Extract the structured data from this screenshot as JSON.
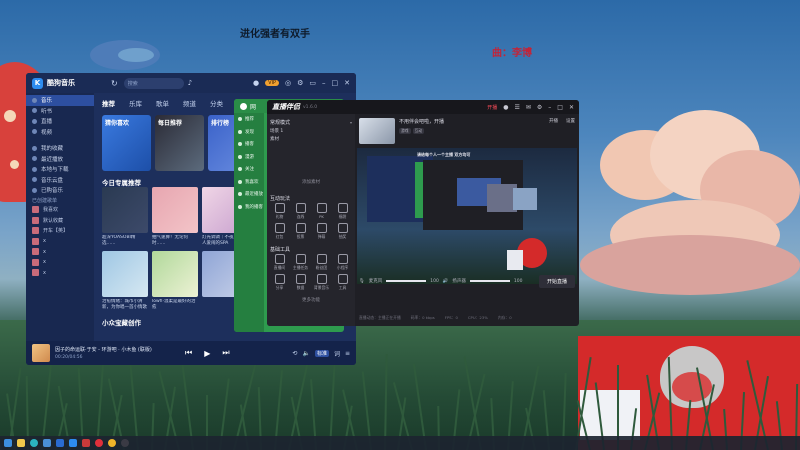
{
  "desktop": {
    "lyric_line": "进化强者有双手",
    "lyric_credit": "曲：李博"
  },
  "kugou": {
    "app_title": "酷狗音乐",
    "search_placeholder": "搜索",
    "sidebar": [
      {
        "label": "音乐",
        "active": true
      },
      {
        "label": "听书",
        "active": false
      },
      {
        "label": "直播",
        "active": false
      },
      {
        "label": "视频",
        "active": false
      },
      {
        "label": "我的收藏",
        "active": false
      },
      {
        "label": "最近播放",
        "active": false
      },
      {
        "label": "本地与下载",
        "active": false
      },
      {
        "label": "音乐云盘",
        "active": false
      },
      {
        "label": "已购音乐",
        "active": false
      }
    ],
    "playlist_header": "已创建歌单",
    "mini_playlists": [
      "我喜欢",
      "默认收藏",
      "开车【英】",
      "x",
      "x",
      "x",
      "x"
    ],
    "tabs": [
      {
        "label": "推荐",
        "active": true
      },
      {
        "label": "乐库",
        "active": false
      },
      {
        "label": "歌单",
        "active": false
      },
      {
        "label": "频道",
        "active": false
      },
      {
        "label": "分类",
        "active": false
      },
      {
        "label": "视频",
        "active": false
      }
    ],
    "cards": [
      {
        "title": "猜你喜欢",
        "subtitle": "",
        "style": "c1"
      },
      {
        "title": "每日推荐",
        "subtitle": "",
        "style": "c2"
      },
      {
        "title": "排行榜",
        "subtitle": "",
        "style": "c3"
      },
      {
        "title": "",
        "subtitle": "",
        "style": "c4"
      }
    ],
    "section_featured": "今日专属推荐",
    "albums_row1": [
      {
        "caption": "超深YOASOBI精选……",
        "colors": [
          "#2a3a52",
          "#3d4a6a"
        ]
      },
      {
        "caption": "抽气速算！无论何时……",
        "colors": [
          "#e7a6b0",
          "#f3c4c8"
        ]
      },
      {
        "caption": "灯光调调｜不夜真……人爱闹的SPA",
        "colors": [
          "#f0d6e6",
          "#c9a2cf"
        ]
      },
      {
        "caption": "",
        "colors": [
          "#d9e8f5",
          "#a4c2e0"
        ]
      }
    ],
    "albums_row2": [
      {
        "caption": "治愈情绪：城市小清新，为你唱一首小情歌",
        "colors": [
          "#9fc7e4",
          "#d6e8f2"
        ]
      },
      {
        "caption": "lowfi·温柔是最好的治愈",
        "colors": [
          "#b0d89a",
          "#edf2d5"
        ]
      },
      {
        "caption": "",
        "colors": [
          "#8fa5d6",
          "#c5cfe8"
        ]
      },
      {
        "caption": "畅白动画：……在发现",
        "colors": [
          "#2c3440",
          "#d4a577"
        ]
      }
    ],
    "section_creator": "小众宝藏创作",
    "player": {
      "song": "因子的命运联·于安 - 环游吧 · 小木鱼 (联版)",
      "time": "00:20/04:56",
      "quality": "标准"
    }
  },
  "green_app": {
    "title_chars": "网",
    "items": [
      "推荐",
      "发现",
      "播客",
      "漫游",
      "关注",
      "我喜欢",
      "最近播放",
      "我的播客"
    ]
  },
  "zhibo": {
    "app_title": "直播伴侣",
    "version": "v1.6.0",
    "top_right": [
      "主播任务",
      "消息",
      "设置"
    ],
    "live_label": "开播",
    "mode_title": "常规模式",
    "mode_sub": "",
    "scenes": [
      "场景 1",
      "素材"
    ],
    "add_source": "添加素材",
    "interactive_title": "互动玩法",
    "interactive_tools": [
      "礼物",
      "连线",
      "PK",
      "福袋",
      "红包",
      "投票",
      "弹幕",
      "抽奖"
    ],
    "basic_title": "基础工具",
    "basic_tools": [
      "直播间",
      "主播任务",
      "粉丝团",
      "小程序",
      "分享",
      "数据",
      "背景音乐",
      "工具"
    ],
    "more_tools": "更多功能",
    "head_title": "不用伴会吧啦，开播",
    "head_tags": [
      "游戏",
      "互动"
    ],
    "head_right": [
      "开播",
      "设置"
    ],
    "audio_labels": [
      "麦克风",
      "扬声器"
    ],
    "audio_levels": [
      100,
      100
    ],
    "start_button": "开始直播",
    "status": [
      "直播动态：主播正在开播",
      "码率：0 kbps",
      "FPS：0",
      "CPU：23%",
      "内存：0"
    ],
    "preview_caption": "请给每个人一个主播 双方均可"
  }
}
